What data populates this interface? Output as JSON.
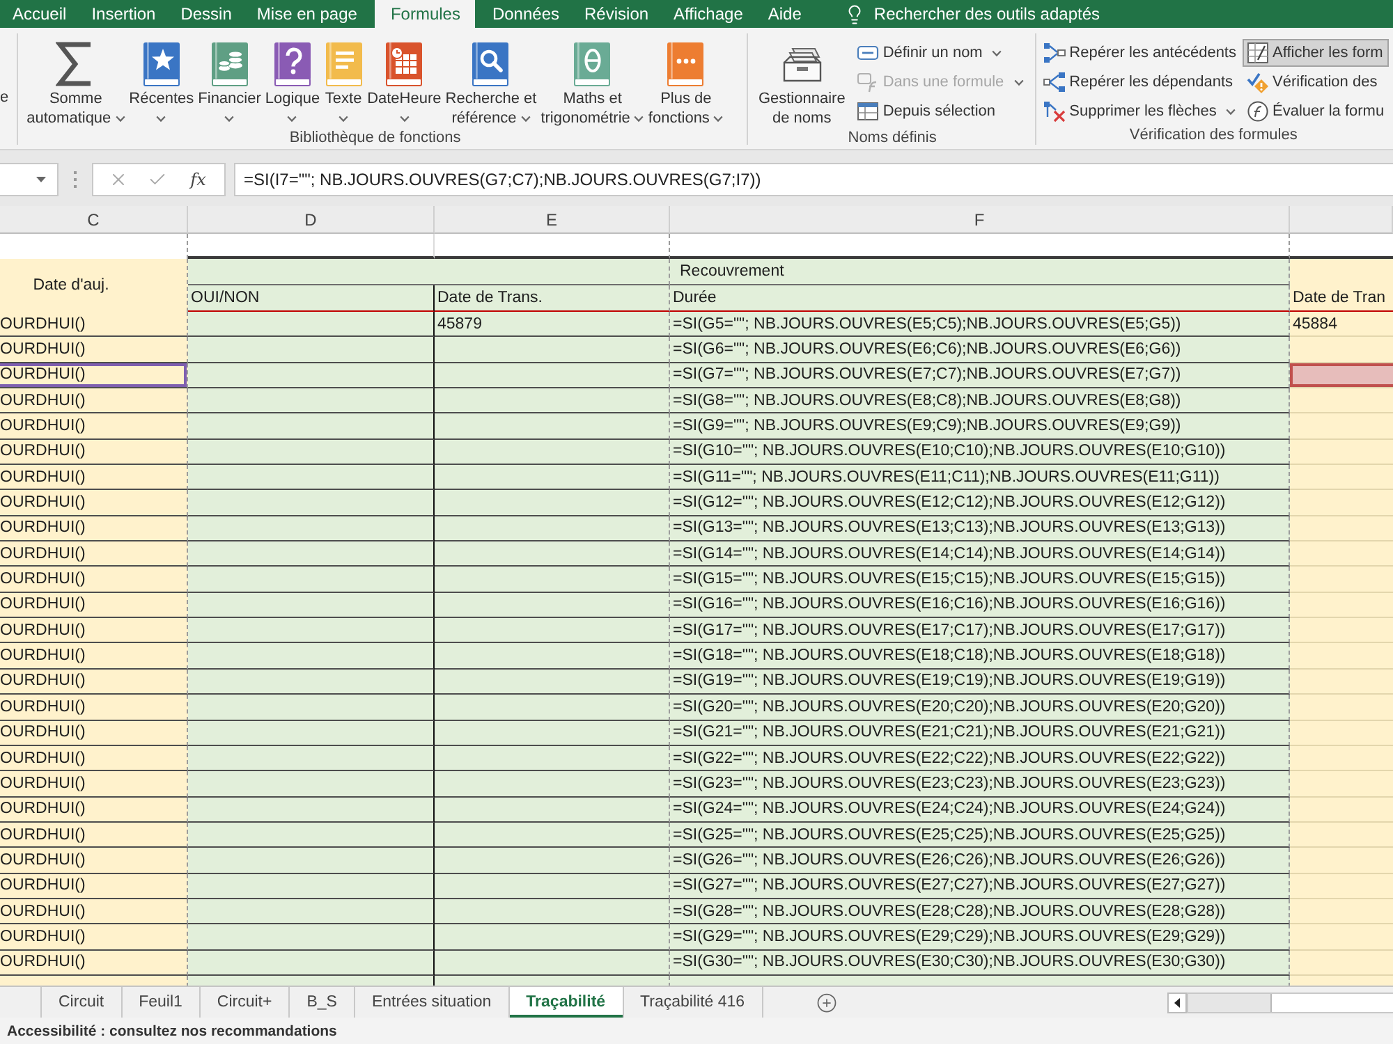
{
  "ribbon_tabs": [
    {
      "label": "Accueil",
      "selected": false
    },
    {
      "label": "Insertion",
      "selected": false
    },
    {
      "label": "Dessin",
      "selected": false
    },
    {
      "label": "Mise en page",
      "selected": false
    },
    {
      "label": "Formules",
      "selected": true
    },
    {
      "label": "Données",
      "selected": false
    },
    {
      "label": "Révision",
      "selected": false
    },
    {
      "label": "Affichage",
      "selected": false
    },
    {
      "label": "Aide",
      "selected": false
    }
  ],
  "tell_me": {
    "label": "Rechercher des outils adaptés"
  },
  "ribbon": {
    "cut_label": "e",
    "groups": [
      {
        "label": "Bibliothèque de fonctions",
        "large_buttons": [
          {
            "lines": [
              "Somme",
              "automatique"
            ],
            "dropdown": true
          },
          {
            "lines": [
              "Récentes"
            ],
            "dropdown": true
          },
          {
            "lines": [
              "Financier"
            ],
            "dropdown": true
          },
          {
            "lines": [
              "Logique"
            ],
            "dropdown": true
          },
          {
            "lines": [
              "Texte"
            ],
            "dropdown": true
          },
          {
            "lines": [
              "DateHeure"
            ],
            "dropdown": true
          },
          {
            "lines": [
              "Recherche et",
              "référence"
            ],
            "dropdown": true
          },
          {
            "lines": [
              "Maths et",
              "trigonométrie"
            ],
            "dropdown": true
          },
          {
            "lines": [
              "Plus de",
              "fonctions"
            ],
            "dropdown": true
          }
        ]
      },
      {
        "label": "Noms définis",
        "large_buttons": [
          {
            "lines": [
              "Gestionnaire",
              "de noms"
            ],
            "dropdown": false
          }
        ],
        "small_columns": [
          [
            {
              "label": "Définir un nom",
              "dropdown": true,
              "disabled": false,
              "on": false
            },
            {
              "label": "Dans une formule",
              "dropdown": true,
              "disabled": true,
              "on": false
            },
            {
              "label": "Depuis sélection",
              "dropdown": false,
              "disabled": false,
              "on": false
            }
          ]
        ]
      },
      {
        "label": "Vérification des formules",
        "small_columns": [
          [
            {
              "label": "Repérer les antécédents",
              "dropdown": false,
              "disabled": false,
              "on": false
            },
            {
              "label": "Repérer les dépendants",
              "dropdown": false,
              "disabled": false,
              "on": false
            },
            {
              "label": "Supprimer les flèches",
              "dropdown": true,
              "disabled": false,
              "on": false
            }
          ],
          [
            {
              "label": "Afficher les form",
              "dropdown": false,
              "disabled": false,
              "on": true
            },
            {
              "label": "Vérification des",
              "dropdown": false,
              "disabled": false,
              "on": false
            },
            {
              "label": "Évaluer la formu",
              "dropdown": false,
              "disabled": false,
              "on": false
            }
          ]
        ]
      }
    ]
  },
  "formula_bar": {
    "function_button": "fx",
    "formula": "=SI(I7=\"\"; NB.JOURS.OUVRES(G7;C7);NB.JOURS.OUVRES(G7;I7))"
  },
  "sheet": {
    "column_headers": [
      "C",
      "D",
      "E",
      "F"
    ],
    "merged_heading": "Date d'auj.",
    "group_heading": "Recouvrement",
    "subheadings": [
      "OUI/NON",
      "Date de Trans.",
      "Durée",
      "Date de Tran"
    ],
    "rows": [
      {
        "c": "OURDHUI()",
        "e": "45879",
        "f": "=SI(G5=\"\"; NB.JOURS.OUVRES(E5;C5);NB.JOURS.OUVRES(E5;G5))",
        "g": "45884"
      },
      {
        "c": "OURDHUI()",
        "f": "=SI(G6=\"\"; NB.JOURS.OUVRES(E6;C6);NB.JOURS.OUVRES(E6;G6))"
      },
      {
        "c": "OURDHUI()",
        "f": "=SI(G7=\"\"; NB.JOURS.OUVRES(E7;C7);NB.JOURS.OUVRES(E7;G7))",
        "highlights": {
          "c": {
            "color": "#7f5fb0",
            "filled": false
          },
          "g": {
            "color": "#c0504d",
            "filled": true
          }
        }
      },
      {
        "c": "OURDHUI()",
        "f": "=SI(G8=\"\"; NB.JOURS.OUVRES(E8;C8);NB.JOURS.OUVRES(E8;G8))"
      },
      {
        "c": "OURDHUI()",
        "f": "=SI(G9=\"\"; NB.JOURS.OUVRES(E9;C9);NB.JOURS.OUVRES(E9;G9))"
      },
      {
        "c": "OURDHUI()",
        "f": "=SI(G10=\"\"; NB.JOURS.OUVRES(E10;C10);NB.JOURS.OUVRES(E10;G10))"
      },
      {
        "c": "OURDHUI()",
        "f": "=SI(G11=\"\"; NB.JOURS.OUVRES(E11;C11);NB.JOURS.OUVRES(E11;G11))"
      },
      {
        "c": "OURDHUI()",
        "f": "=SI(G12=\"\"; NB.JOURS.OUVRES(E12;C12);NB.JOURS.OUVRES(E12;G12))"
      },
      {
        "c": "OURDHUI()",
        "f": "=SI(G13=\"\"; NB.JOURS.OUVRES(E13;C13);NB.JOURS.OUVRES(E13;G13))"
      },
      {
        "c": "OURDHUI()",
        "f": "=SI(G14=\"\"; NB.JOURS.OUVRES(E14;C14);NB.JOURS.OUVRES(E14;G14))"
      },
      {
        "c": "OURDHUI()",
        "f": "=SI(G15=\"\"; NB.JOURS.OUVRES(E15;C15);NB.JOURS.OUVRES(E15;G15))"
      },
      {
        "c": "OURDHUI()",
        "f": "=SI(G16=\"\"; NB.JOURS.OUVRES(E16;C16);NB.JOURS.OUVRES(E16;G16))"
      },
      {
        "c": "OURDHUI()",
        "f": "=SI(G17=\"\"; NB.JOURS.OUVRES(E17;C17);NB.JOURS.OUVRES(E17;G17))"
      },
      {
        "c": "OURDHUI()",
        "f": "=SI(G18=\"\"; NB.JOURS.OUVRES(E18;C18);NB.JOURS.OUVRES(E18;G18))"
      },
      {
        "c": "OURDHUI()",
        "f": "=SI(G19=\"\"; NB.JOURS.OUVRES(E19;C19);NB.JOURS.OUVRES(E19;G19))"
      },
      {
        "c": "OURDHUI()",
        "f": "=SI(G20=\"\"; NB.JOURS.OUVRES(E20;C20);NB.JOURS.OUVRES(E20;G20))"
      },
      {
        "c": "OURDHUI()",
        "f": "=SI(G21=\"\"; NB.JOURS.OUVRES(E21;C21);NB.JOURS.OUVRES(E21;G21))"
      },
      {
        "c": "OURDHUI()",
        "f": "=SI(G22=\"\"; NB.JOURS.OUVRES(E22;C22);NB.JOURS.OUVRES(E22;G22))"
      },
      {
        "c": "OURDHUI()",
        "f": "=SI(G23=\"\"; NB.JOURS.OUVRES(E23;C23);NB.JOURS.OUVRES(E23;G23))"
      },
      {
        "c": "OURDHUI()",
        "f": "=SI(G24=\"\"; NB.JOURS.OUVRES(E24;C24);NB.JOURS.OUVRES(E24;G24))"
      },
      {
        "c": "OURDHUI()",
        "f": "=SI(G25=\"\"; NB.JOURS.OUVRES(E25;C25);NB.JOURS.OUVRES(E25;G25))"
      },
      {
        "c": "OURDHUI()",
        "f": "=SI(G26=\"\"; NB.JOURS.OUVRES(E26;C26);NB.JOURS.OUVRES(E26;G26))"
      },
      {
        "c": "OURDHUI()",
        "f": "=SI(G27=\"\"; NB.JOURS.OUVRES(E27;C27);NB.JOURS.OUVRES(E27;G27))"
      },
      {
        "c": "OURDHUI()",
        "f": "=SI(G28=\"\"; NB.JOURS.OUVRES(E28;C28);NB.JOURS.OUVRES(E28;G28))"
      },
      {
        "c": "OURDHUI()",
        "f": "=SI(G29=\"\"; NB.JOURS.OUVRES(E29;C29);NB.JOURS.OUVRES(E29;G29))"
      },
      {
        "c": "OURDHUI()",
        "f": "=SI(G30=\"\"; NB.JOURS.OUVRES(E30;C30);NB.JOURS.OUVRES(E30;G30))"
      }
    ]
  },
  "sheet_tabs": [
    {
      "label": "Circuit",
      "selected": false
    },
    {
      "label": "Feuil1",
      "selected": false
    },
    {
      "label": "Circuit+",
      "selected": false
    },
    {
      "label": "B_S",
      "selected": false
    },
    {
      "label": "Entrées situation",
      "selected": false
    },
    {
      "label": "Traçabilité",
      "selected": true
    },
    {
      "label": "Traçabilité 416",
      "selected": false
    }
  ],
  "status_bar": {
    "text": "Accessibilité : consultez nos recommandations"
  }
}
